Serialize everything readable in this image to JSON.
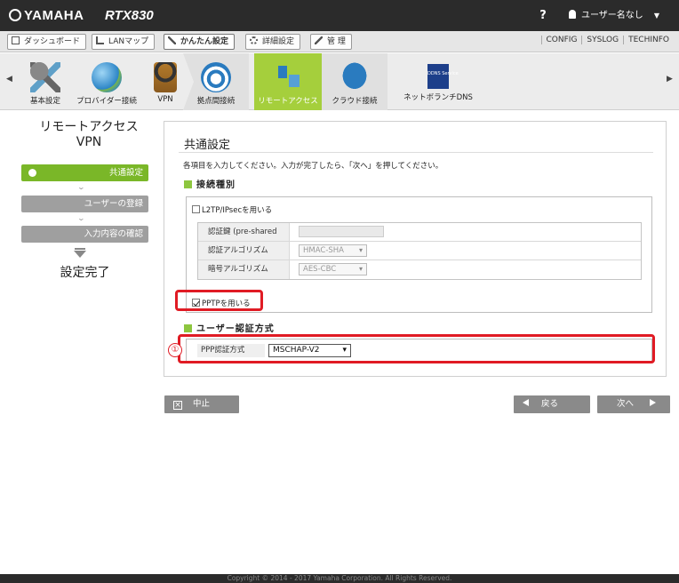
{
  "header": {
    "brand": "YAMAHA",
    "model": "RTX830",
    "help": "?",
    "user": "ユーザー名なし"
  },
  "tabs": [
    {
      "label": "ダッシュボード",
      "icon": "dashboard-icon"
    },
    {
      "label": "LANマップ",
      "icon": "lan-map-icon"
    },
    {
      "label": "かんたん設定",
      "icon": "wizard-icon",
      "active": true
    },
    {
      "label": "詳細設定",
      "icon": "gear-icon"
    },
    {
      "label": "管 理",
      "icon": "wrench-icon"
    }
  ],
  "top_links": [
    "CONFIG",
    "SYSLOG",
    "TECHINFO"
  ],
  "ribbon": [
    {
      "label": "基本設定",
      "icon": "tools-icon"
    },
    {
      "label": "プロバイダー接続",
      "icon": "globe-icon"
    },
    {
      "label": "VPN",
      "icon": "vpn-lock-icon"
    },
    {
      "label": "拠点間接続",
      "icon": "site-to-site-icon"
    },
    {
      "label": "リモートアクセス",
      "icon": "remote-access-icon",
      "active": true
    },
    {
      "label": "クラウド接続",
      "icon": "cloud-icon"
    },
    {
      "label": "ネットボランチDNS",
      "icon": "ddns-icon",
      "badge": "DDNS Service"
    }
  ],
  "wizard": {
    "title_line1": "リモートアクセス",
    "title_line2": "VPN",
    "steps": [
      {
        "label": "共通設定",
        "active": true
      },
      {
        "label": "ユーザーの登録"
      },
      {
        "label": "入力内容の確認"
      }
    ],
    "done": "設定完了"
  },
  "main": {
    "title": "共通設定",
    "instruction": "各項目を入力してください。入力が完了したら、「次へ」を押してください。",
    "section1": "接続種別",
    "l2tp_label": "L2TP/IPsecを用いる",
    "l2tp_checked": false,
    "psk_label": "認証鍵 (pre-shared key)",
    "psk_value": "",
    "auth_algo_label": "認証アルゴリズム",
    "auth_algo_value": "HMAC-SHA",
    "enc_algo_label": "暗号アルゴリズム",
    "enc_algo_value": "AES-CBC",
    "pptp_label": "PPTPを用いる",
    "pptp_checked": true,
    "section2": "ユーザー認証方式",
    "ppp_label": "PPP認証方式",
    "ppp_value": "MSCHAP-V2",
    "callout": "①"
  },
  "buttons": {
    "cancel": "中止",
    "back": "戻る",
    "next": "次へ"
  },
  "footer": "Copyright © 2014 - 2017 Yamaha Corporation. All Rights Reserved.",
  "colors": {
    "accent_green": "#8dc63f",
    "highlight_red": "#e01b24",
    "topbar": "#2b2b2b"
  }
}
